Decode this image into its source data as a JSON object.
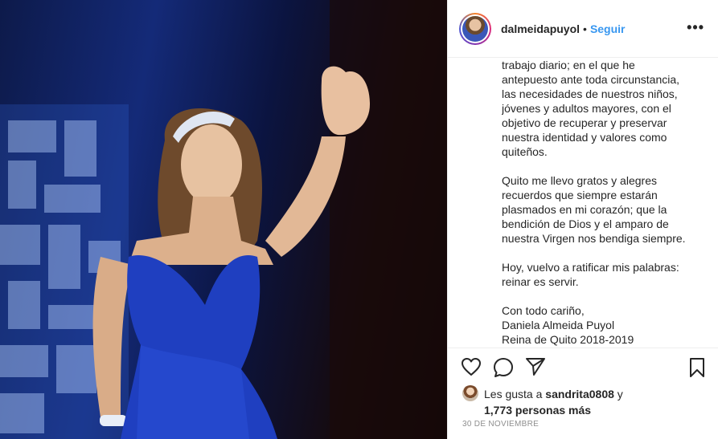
{
  "post": {
    "username": "dalmeidapuyol",
    "separator": "•",
    "follow_label": "Seguir",
    "more_label": "•••",
    "caption_paragraphs": [
      "trabajo diario; en el que he\nantepuesto ante toda circunstancia,\nlas necesidades de nuestros niños,\njóvenes y adultos mayores, con el\nobjetivo de recuperar y preservar\nnuestra identidad y valores como\nquiteños.",
      "Quito me llevo gratos y alegres\nrecuerdos que siempre estarán\nplasmados en mi corazón; que la\nbendición de Dios y el amparo de\nnuestra Virgen nos bendiga siempre.",
      "Hoy, vuelvo a ratificar mis palabras:\nreinar es servir.",
      "Con todo cariño,\nDaniela Almeida Puyol\nReina de Quito 2018-2019"
    ],
    "likes": {
      "prefix": "Les gusta a ",
      "user": "sandrita0808",
      "connector": " y",
      "count": "1,773 personas más"
    },
    "date": "30 DE NOVIEMBRE"
  },
  "icons": {
    "like": "heart-icon",
    "comment": "comment-icon",
    "share": "share-icon",
    "save": "bookmark-icon"
  },
  "colors": {
    "link_blue": "#3897f0",
    "text": "#262626",
    "muted": "#8e8e8e",
    "border": "#efefef"
  }
}
